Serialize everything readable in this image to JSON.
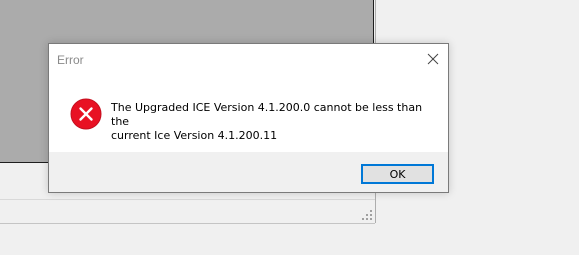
{
  "dialog": {
    "title": "Error",
    "message": "The Upgraded ICE Version 4.1.200.0 cannot be less than the\ncurrent Ice Version 4.1.200.11",
    "icon": "error-icon",
    "ok_label": "OK",
    "close_icon": "close-icon"
  },
  "colors": {
    "error_red": "#e81123",
    "accent": "#0078d7",
    "title_text": "#8a8a8a"
  }
}
